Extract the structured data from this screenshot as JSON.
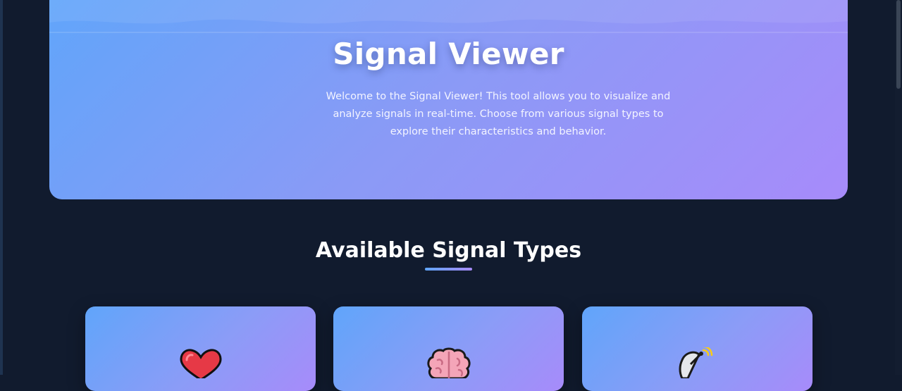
{
  "hero": {
    "title": "Signal Viewer",
    "description": "Welcome to the Signal Viewer! This tool allows you to visualize and analyze signals in real-time. Choose from various signal types to explore their characteristics and behavior."
  },
  "section": {
    "title": "Available Signal Types"
  },
  "cards": [
    {
      "icon": "heart-icon"
    },
    {
      "icon": "brain-icon"
    },
    {
      "icon": "satellite-dish-icon"
    }
  ],
  "colors": {
    "page_background": "#111b2e",
    "gradient_start": "#60a5fa",
    "gradient_end": "#a78bfa",
    "heart": "#e63946",
    "brain": "#f4a5b8"
  }
}
